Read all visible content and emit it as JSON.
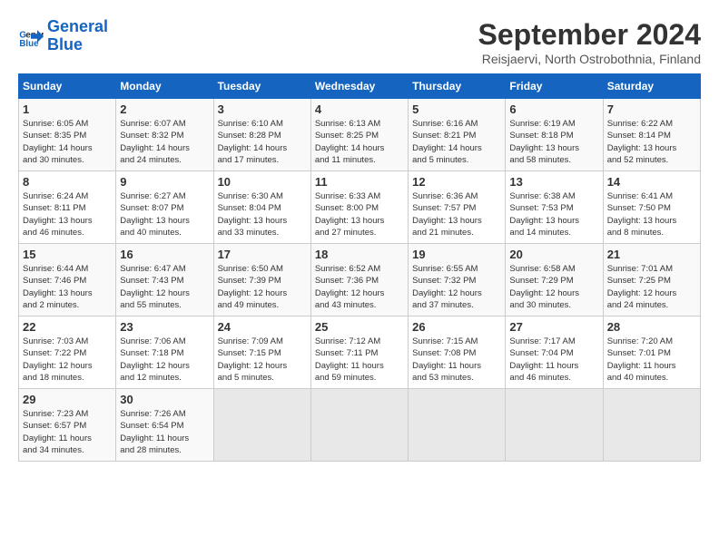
{
  "header": {
    "logo_line1": "General",
    "logo_line2": "Blue",
    "month": "September 2024",
    "location": "Reisjaervi, North Ostrobothnia, Finland"
  },
  "days_of_week": [
    "Sunday",
    "Monday",
    "Tuesday",
    "Wednesday",
    "Thursday",
    "Friday",
    "Saturday"
  ],
  "weeks": [
    [
      {
        "day": "1",
        "info": "Sunrise: 6:05 AM\nSunset: 8:35 PM\nDaylight: 14 hours\nand 30 minutes."
      },
      {
        "day": "2",
        "info": "Sunrise: 6:07 AM\nSunset: 8:32 PM\nDaylight: 14 hours\nand 24 minutes."
      },
      {
        "day": "3",
        "info": "Sunrise: 6:10 AM\nSunset: 8:28 PM\nDaylight: 14 hours\nand 17 minutes."
      },
      {
        "day": "4",
        "info": "Sunrise: 6:13 AM\nSunset: 8:25 PM\nDaylight: 14 hours\nand 11 minutes."
      },
      {
        "day": "5",
        "info": "Sunrise: 6:16 AM\nSunset: 8:21 PM\nDaylight: 14 hours\nand 5 minutes."
      },
      {
        "day": "6",
        "info": "Sunrise: 6:19 AM\nSunset: 8:18 PM\nDaylight: 13 hours\nand 58 minutes."
      },
      {
        "day": "7",
        "info": "Sunrise: 6:22 AM\nSunset: 8:14 PM\nDaylight: 13 hours\nand 52 minutes."
      }
    ],
    [
      {
        "day": "8",
        "info": "Sunrise: 6:24 AM\nSunset: 8:11 PM\nDaylight: 13 hours\nand 46 minutes."
      },
      {
        "day": "9",
        "info": "Sunrise: 6:27 AM\nSunset: 8:07 PM\nDaylight: 13 hours\nand 40 minutes."
      },
      {
        "day": "10",
        "info": "Sunrise: 6:30 AM\nSunset: 8:04 PM\nDaylight: 13 hours\nand 33 minutes."
      },
      {
        "day": "11",
        "info": "Sunrise: 6:33 AM\nSunset: 8:00 PM\nDaylight: 13 hours\nand 27 minutes."
      },
      {
        "day": "12",
        "info": "Sunrise: 6:36 AM\nSunset: 7:57 PM\nDaylight: 13 hours\nand 21 minutes."
      },
      {
        "day": "13",
        "info": "Sunrise: 6:38 AM\nSunset: 7:53 PM\nDaylight: 13 hours\nand 14 minutes."
      },
      {
        "day": "14",
        "info": "Sunrise: 6:41 AM\nSunset: 7:50 PM\nDaylight: 13 hours\nand 8 minutes."
      }
    ],
    [
      {
        "day": "15",
        "info": "Sunrise: 6:44 AM\nSunset: 7:46 PM\nDaylight: 13 hours\nand 2 minutes."
      },
      {
        "day": "16",
        "info": "Sunrise: 6:47 AM\nSunset: 7:43 PM\nDaylight: 12 hours\nand 55 minutes."
      },
      {
        "day": "17",
        "info": "Sunrise: 6:50 AM\nSunset: 7:39 PM\nDaylight: 12 hours\nand 49 minutes."
      },
      {
        "day": "18",
        "info": "Sunrise: 6:52 AM\nSunset: 7:36 PM\nDaylight: 12 hours\nand 43 minutes."
      },
      {
        "day": "19",
        "info": "Sunrise: 6:55 AM\nSunset: 7:32 PM\nDaylight: 12 hours\nand 37 minutes."
      },
      {
        "day": "20",
        "info": "Sunrise: 6:58 AM\nSunset: 7:29 PM\nDaylight: 12 hours\nand 30 minutes."
      },
      {
        "day": "21",
        "info": "Sunrise: 7:01 AM\nSunset: 7:25 PM\nDaylight: 12 hours\nand 24 minutes."
      }
    ],
    [
      {
        "day": "22",
        "info": "Sunrise: 7:03 AM\nSunset: 7:22 PM\nDaylight: 12 hours\nand 18 minutes."
      },
      {
        "day": "23",
        "info": "Sunrise: 7:06 AM\nSunset: 7:18 PM\nDaylight: 12 hours\nand 12 minutes."
      },
      {
        "day": "24",
        "info": "Sunrise: 7:09 AM\nSunset: 7:15 PM\nDaylight: 12 hours\nand 5 minutes."
      },
      {
        "day": "25",
        "info": "Sunrise: 7:12 AM\nSunset: 7:11 PM\nDaylight: 11 hours\nand 59 minutes."
      },
      {
        "day": "26",
        "info": "Sunrise: 7:15 AM\nSunset: 7:08 PM\nDaylight: 11 hours\nand 53 minutes."
      },
      {
        "day": "27",
        "info": "Sunrise: 7:17 AM\nSunset: 7:04 PM\nDaylight: 11 hours\nand 46 minutes."
      },
      {
        "day": "28",
        "info": "Sunrise: 7:20 AM\nSunset: 7:01 PM\nDaylight: 11 hours\nand 40 minutes."
      }
    ],
    [
      {
        "day": "29",
        "info": "Sunrise: 7:23 AM\nSunset: 6:57 PM\nDaylight: 11 hours\nand 34 minutes."
      },
      {
        "day": "30",
        "info": "Sunrise: 7:26 AM\nSunset: 6:54 PM\nDaylight: 11 hours\nand 28 minutes."
      },
      {
        "day": "",
        "info": ""
      },
      {
        "day": "",
        "info": ""
      },
      {
        "day": "",
        "info": ""
      },
      {
        "day": "",
        "info": ""
      },
      {
        "day": "",
        "info": ""
      }
    ]
  ]
}
